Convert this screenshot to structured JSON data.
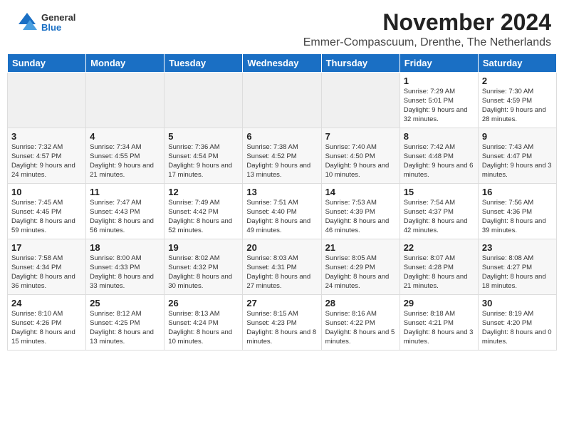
{
  "logo": {
    "general": "General",
    "blue": "Blue"
  },
  "title": "November 2024",
  "location": "Emmer-Compascuum, Drenthe, The Netherlands",
  "days_of_week": [
    "Sunday",
    "Monday",
    "Tuesday",
    "Wednesday",
    "Thursday",
    "Friday",
    "Saturday"
  ],
  "weeks": [
    [
      {
        "day": "",
        "info": ""
      },
      {
        "day": "",
        "info": ""
      },
      {
        "day": "",
        "info": ""
      },
      {
        "day": "",
        "info": ""
      },
      {
        "day": "",
        "info": ""
      },
      {
        "day": "1",
        "info": "Sunrise: 7:29 AM\nSunset: 5:01 PM\nDaylight: 9 hours and 32 minutes."
      },
      {
        "day": "2",
        "info": "Sunrise: 7:30 AM\nSunset: 4:59 PM\nDaylight: 9 hours and 28 minutes."
      }
    ],
    [
      {
        "day": "3",
        "info": "Sunrise: 7:32 AM\nSunset: 4:57 PM\nDaylight: 9 hours and 24 minutes."
      },
      {
        "day": "4",
        "info": "Sunrise: 7:34 AM\nSunset: 4:55 PM\nDaylight: 9 hours and 21 minutes."
      },
      {
        "day": "5",
        "info": "Sunrise: 7:36 AM\nSunset: 4:54 PM\nDaylight: 9 hours and 17 minutes."
      },
      {
        "day": "6",
        "info": "Sunrise: 7:38 AM\nSunset: 4:52 PM\nDaylight: 9 hours and 13 minutes."
      },
      {
        "day": "7",
        "info": "Sunrise: 7:40 AM\nSunset: 4:50 PM\nDaylight: 9 hours and 10 minutes."
      },
      {
        "day": "8",
        "info": "Sunrise: 7:42 AM\nSunset: 4:48 PM\nDaylight: 9 hours and 6 minutes."
      },
      {
        "day": "9",
        "info": "Sunrise: 7:43 AM\nSunset: 4:47 PM\nDaylight: 9 hours and 3 minutes."
      }
    ],
    [
      {
        "day": "10",
        "info": "Sunrise: 7:45 AM\nSunset: 4:45 PM\nDaylight: 8 hours and 59 minutes."
      },
      {
        "day": "11",
        "info": "Sunrise: 7:47 AM\nSunset: 4:43 PM\nDaylight: 8 hours and 56 minutes."
      },
      {
        "day": "12",
        "info": "Sunrise: 7:49 AM\nSunset: 4:42 PM\nDaylight: 8 hours and 52 minutes."
      },
      {
        "day": "13",
        "info": "Sunrise: 7:51 AM\nSunset: 4:40 PM\nDaylight: 8 hours and 49 minutes."
      },
      {
        "day": "14",
        "info": "Sunrise: 7:53 AM\nSunset: 4:39 PM\nDaylight: 8 hours and 46 minutes."
      },
      {
        "day": "15",
        "info": "Sunrise: 7:54 AM\nSunset: 4:37 PM\nDaylight: 8 hours and 42 minutes."
      },
      {
        "day": "16",
        "info": "Sunrise: 7:56 AM\nSunset: 4:36 PM\nDaylight: 8 hours and 39 minutes."
      }
    ],
    [
      {
        "day": "17",
        "info": "Sunrise: 7:58 AM\nSunset: 4:34 PM\nDaylight: 8 hours and 36 minutes."
      },
      {
        "day": "18",
        "info": "Sunrise: 8:00 AM\nSunset: 4:33 PM\nDaylight: 8 hours and 33 minutes."
      },
      {
        "day": "19",
        "info": "Sunrise: 8:02 AM\nSunset: 4:32 PM\nDaylight: 8 hours and 30 minutes."
      },
      {
        "day": "20",
        "info": "Sunrise: 8:03 AM\nSunset: 4:31 PM\nDaylight: 8 hours and 27 minutes."
      },
      {
        "day": "21",
        "info": "Sunrise: 8:05 AM\nSunset: 4:29 PM\nDaylight: 8 hours and 24 minutes."
      },
      {
        "day": "22",
        "info": "Sunrise: 8:07 AM\nSunset: 4:28 PM\nDaylight: 8 hours and 21 minutes."
      },
      {
        "day": "23",
        "info": "Sunrise: 8:08 AM\nSunset: 4:27 PM\nDaylight: 8 hours and 18 minutes."
      }
    ],
    [
      {
        "day": "24",
        "info": "Sunrise: 8:10 AM\nSunset: 4:26 PM\nDaylight: 8 hours and 15 minutes."
      },
      {
        "day": "25",
        "info": "Sunrise: 8:12 AM\nSunset: 4:25 PM\nDaylight: 8 hours and 13 minutes."
      },
      {
        "day": "26",
        "info": "Sunrise: 8:13 AM\nSunset: 4:24 PM\nDaylight: 8 hours and 10 minutes."
      },
      {
        "day": "27",
        "info": "Sunrise: 8:15 AM\nSunset: 4:23 PM\nDaylight: 8 hours and 8 minutes."
      },
      {
        "day": "28",
        "info": "Sunrise: 8:16 AM\nSunset: 4:22 PM\nDaylight: 8 hours and 5 minutes."
      },
      {
        "day": "29",
        "info": "Sunrise: 8:18 AM\nSunset: 4:21 PM\nDaylight: 8 hours and 3 minutes."
      },
      {
        "day": "30",
        "info": "Sunrise: 8:19 AM\nSunset: 4:20 PM\nDaylight: 8 hours and 0 minutes."
      }
    ]
  ]
}
